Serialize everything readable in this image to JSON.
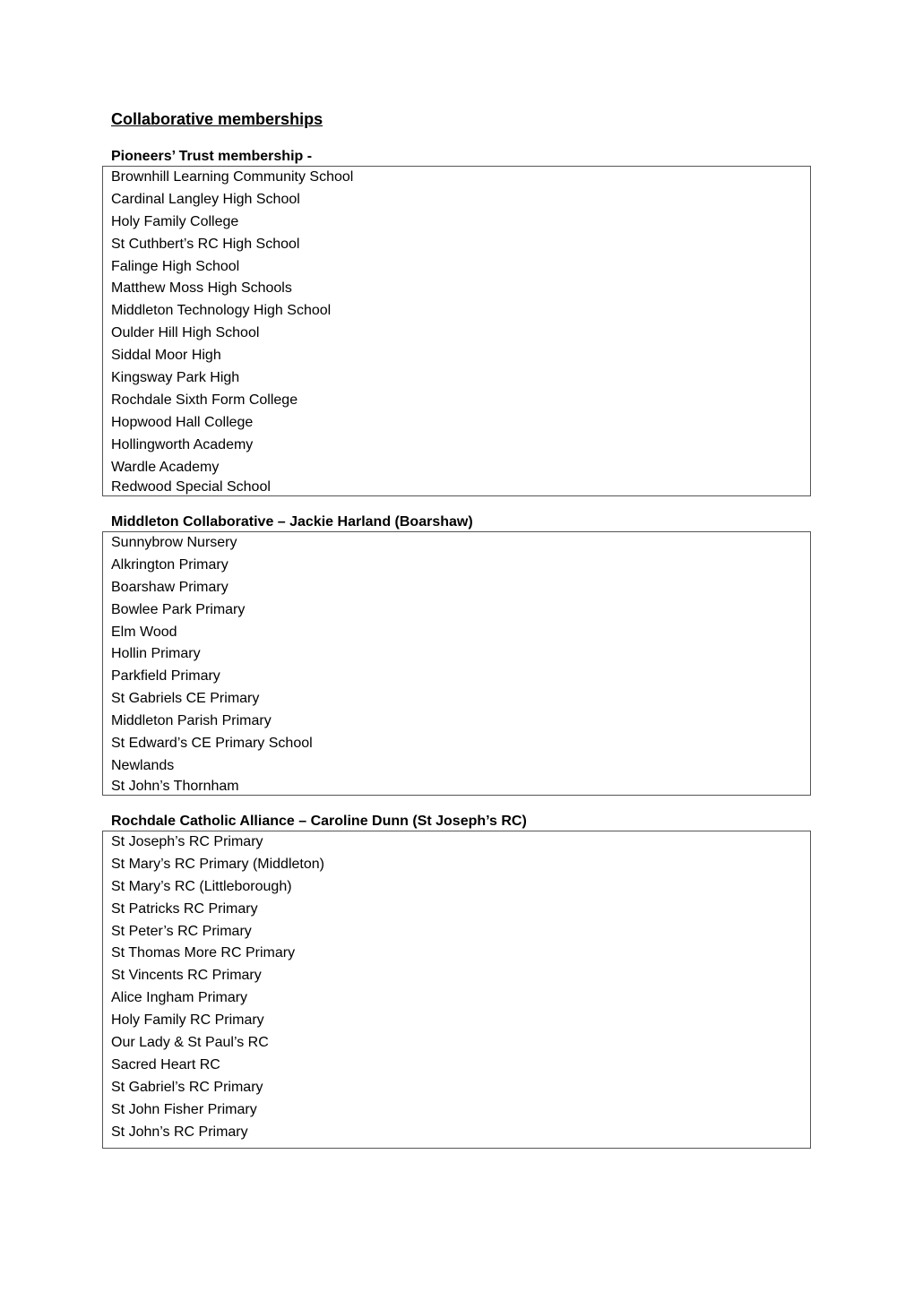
{
  "document": {
    "title": "Collaborative memberships",
    "sections": [
      {
        "heading": "Pioneers’ Trust membership -",
        "members": [
          "Brownhill Learning Community School",
          "Cardinal Langley High School",
          "Holy Family College",
          "St Cuthbert’s RC High School",
          "Falinge High School",
          "Matthew Moss High Schools",
          "Middleton Technology High School",
          "Oulder Hill High School",
          "Siddal Moor High",
          "Kingsway Park High",
          "Rochdale Sixth Form College",
          "Hopwood Hall College",
          "Hollingworth Academy",
          "Wardle Academy",
          "Redwood Special School"
        ]
      },
      {
        "heading": "Middleton Collaborative – Jackie Harland (Boarshaw)",
        "members": [
          "Sunnybrow Nursery",
          "Alkrington Primary",
          "Boarshaw Primary",
          "Bowlee Park Primary",
          "Elm Wood",
          "Hollin Primary",
          "Parkfield Primary",
          "St Gabriels CE Primary",
          "Middleton Parish Primary",
          "St Edward’s CE Primary School",
          "Newlands",
          "St John’s Thornham"
        ]
      },
      {
        "heading": "Rochdale Catholic Alliance – Caroline Dunn (St Joseph’s RC)",
        "members": [
          "St Joseph’s RC Primary",
          "St Mary’s RC Primary (Middleton)",
          "St Mary’s RC (Littleborough)",
          "St Patricks RC Primary",
          "St Peter’s RC Primary",
          "St Thomas More RC Primary",
          "St Vincents RC Primary",
          "Alice Ingham Primary",
          "Holy Family RC Primary",
          "Our Lady & St Paul’s RC",
          "Sacred Heart RC",
          "St Gabriel’s RC Primary",
          "St John Fisher Primary",
          "St John’s RC Primary"
        ]
      }
    ]
  }
}
